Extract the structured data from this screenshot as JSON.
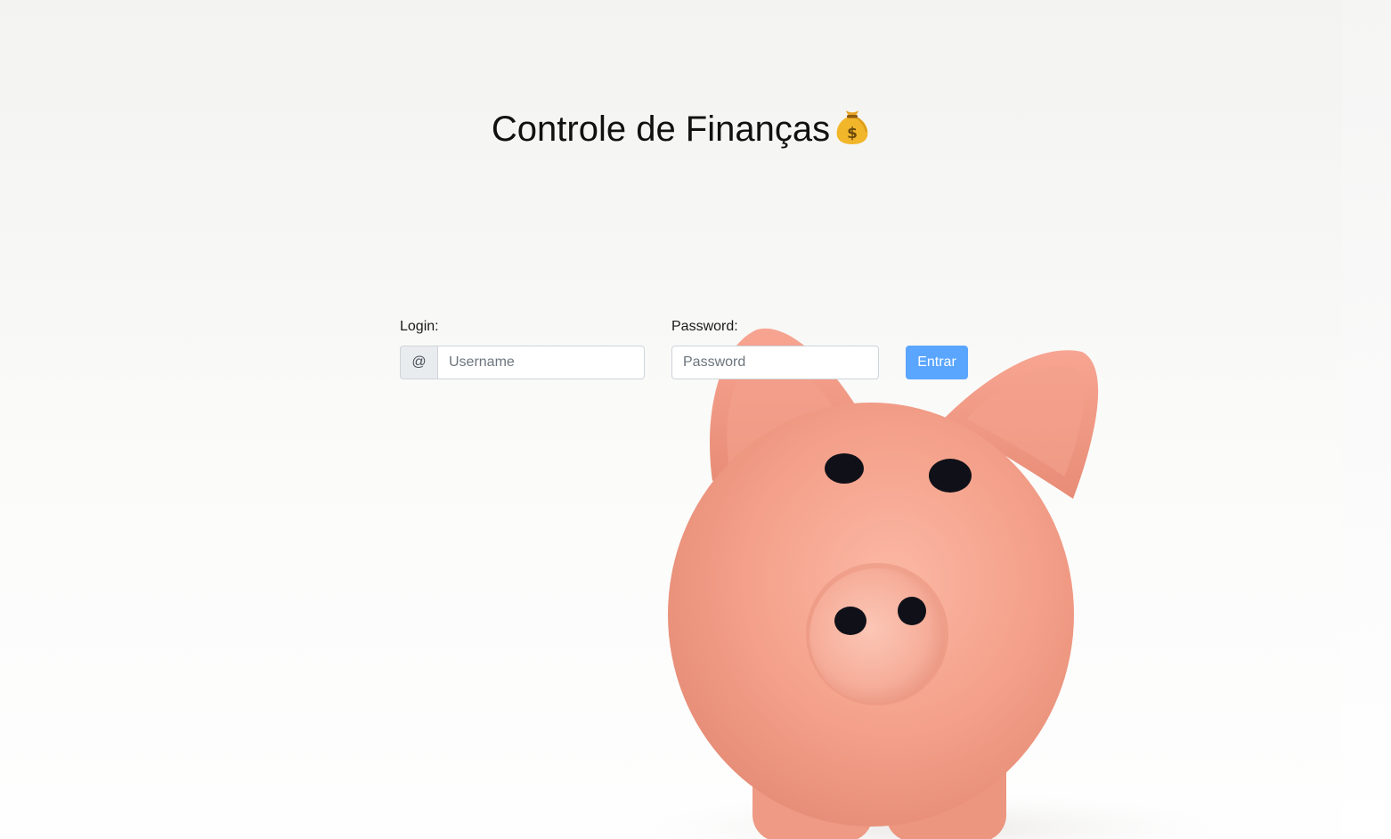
{
  "page": {
    "title": "Controle de Finanças",
    "title_icon": "money-bag-icon",
    "background_image": "piggy-bank-photo"
  },
  "login_form": {
    "login_label": "Login:",
    "at_symbol": "@",
    "username_placeholder": "Username",
    "username_value": "",
    "password_label": "Password:",
    "password_placeholder": "Password",
    "password_value": "",
    "submit_label": "Entrar"
  },
  "colors": {
    "submit_button": "#5aa6ff",
    "piggy_bank": "#f4a38e"
  }
}
